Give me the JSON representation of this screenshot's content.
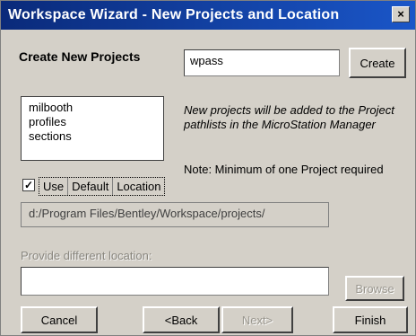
{
  "window": {
    "title": "Workspace Wizard - New Projects and Location",
    "close_glyph": "×"
  },
  "create": {
    "label": "Create New Projects",
    "input_value": "wpass",
    "create_button": "Create"
  },
  "projects_list": [
    "milbooth",
    "profiles",
    "sections"
  ],
  "info": {
    "message": "New projects will be added to the Project pathlists in the MicroStation Manager",
    "note": "Note: Minimum of one Project required"
  },
  "default_location": {
    "checkbox_mark": "✓",
    "parts": [
      "Use",
      "Default",
      "Location"
    ]
  },
  "path_value": "d:/Program Files/Bentley/Workspace/projects/",
  "different_location": {
    "label": "Provide different location:",
    "input_value": "",
    "browse_button": "Browse"
  },
  "buttons": {
    "cancel": "Cancel",
    "back": "<Back",
    "next": "Next>",
    "finish": "Finish"
  }
}
